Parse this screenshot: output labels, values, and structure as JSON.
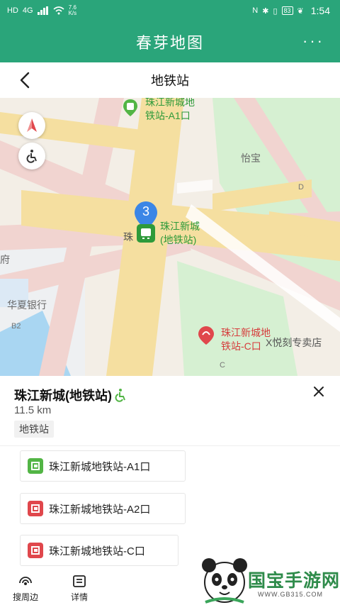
{
  "status_bar": {
    "network_left": "HD",
    "signal": "4G",
    "speed_value": "7.6",
    "speed_unit": "K/s",
    "battery": "83",
    "time": "1:54"
  },
  "app_bar": {
    "title": "春芽地图",
    "more_label": "···"
  },
  "page": {
    "title": "地铁站"
  },
  "map": {
    "labels": {
      "a1_line1": "珠江新城地",
      "a1_line2": "铁站-A1口",
      "yibao": "怡宝",
      "d": "D",
      "station_line1": "珠江新城",
      "station_line2": "(地铁站)",
      "station_prefix": "珠",
      "fu": "府",
      "huaxia": "华夏银行",
      "b2": "B2",
      "c_exit_line1": "珠江新城地",
      "c_exit_line2": "铁站-C口",
      "shop": "X悦刻专卖店",
      "c": "C"
    },
    "marker_number": "3"
  },
  "poi": {
    "name": "珠江新城(地铁站)",
    "distance": "11.5 km",
    "tag": "地铁站"
  },
  "exits": [
    {
      "label": "珠江新城地铁站-A1口",
      "color": "#52b545"
    },
    {
      "label": "珠江新城地铁站-A2口",
      "color": "#e0474c"
    },
    {
      "label": "珠江新城地铁站-C口",
      "color": "#e0474c"
    }
  ],
  "bottom_nav": {
    "nearby": "搜周边",
    "details": "详情"
  },
  "watermark": {
    "title": "国宝手游网",
    "url": "WWW.GB315.COM"
  },
  "colors": {
    "primary": "#2aa57a",
    "road": "#f5dfa0",
    "road_pink": "#f1d4d0",
    "park": "#d6f0d2",
    "water": "#a9d6f2"
  }
}
